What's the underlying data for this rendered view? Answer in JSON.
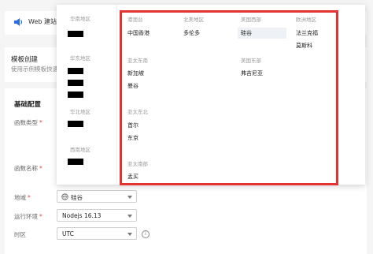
{
  "banner": {
    "text": "Web 建站全新"
  },
  "template_section": {
    "title": "模板创建",
    "subtitle": "使用示例模板快速创建"
  },
  "basic_config": {
    "title": "基础配置",
    "fields": [
      {
        "label": "函数类型",
        "required": true
      },
      {
        "label": "函数名称",
        "required": true
      },
      {
        "label": "地域",
        "required": true,
        "value": "硅谷"
      },
      {
        "label": "运行环境",
        "required": true,
        "value": "Nodejs 16.13"
      },
      {
        "label": "时区",
        "required": false,
        "value": "UTC"
      }
    ]
  },
  "dropdown": {
    "left_areas": [
      "华南地区",
      "华东地区",
      "华北地区",
      "西南地区"
    ],
    "groups": [
      {
        "title": "港澳台",
        "items": [
          "中国香港"
        ]
      },
      {
        "title": "北美地区",
        "items": [
          "多伦多"
        ]
      },
      {
        "title": "美国西部",
        "items": [
          "硅谷"
        ]
      },
      {
        "title": "欧洲地区",
        "items": [
          "法兰克福",
          "莫斯科"
        ]
      },
      {
        "title": "亚太东南",
        "items": [
          "新加坡",
          "曼谷"
        ]
      },
      {
        "title": "美国东部",
        "items": [
          "弗吉尼亚"
        ]
      },
      {
        "title": "亚太东北",
        "items": [
          "首尔",
          "东京"
        ]
      },
      {
        "title": "亚太南部",
        "items": [
          "孟买"
        ]
      }
    ],
    "selected": "硅谷"
  },
  "colors": {
    "highlight_frame": "#e23232",
    "selected_bg": "#eef1f5",
    "required": "#e54545"
  }
}
